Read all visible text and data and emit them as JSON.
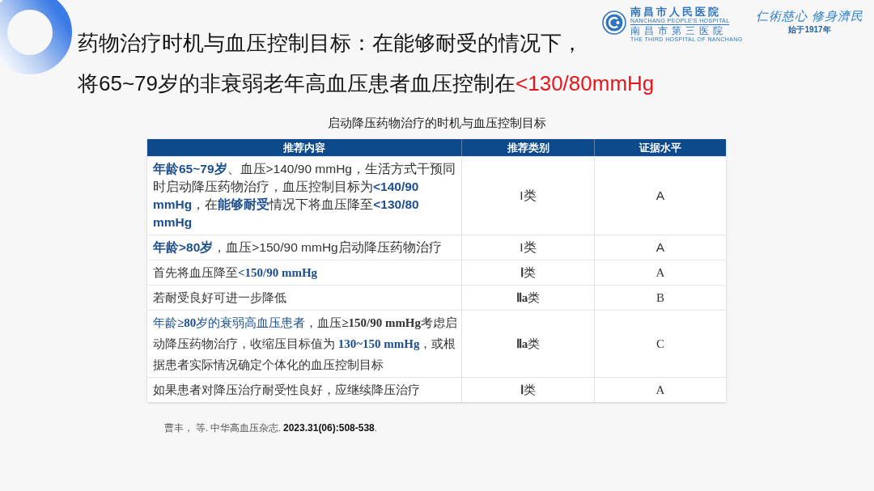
{
  "title": {
    "lines": [
      {
        "runs": [
          {
            "text": "药物治疗时机与血压控制目标：在能够耐受的情况下，",
            "highlight": false
          }
        ]
      },
      {
        "runs": [
          {
            "text": "将65~79岁的非衰弱老年高血压患者血压控制在",
            "highlight": false
          },
          {
            "text": "<130/80mmHg",
            "highlight": true
          }
        ]
      }
    ]
  },
  "logo": {
    "name": "南昌市人民医院",
    "name_en": "NANCHANG PEOPLE'S HOSPITAL",
    "alt_name": "南昌市第三医院",
    "alt_name_en": "THE THIRD HOSPITAL OF NANCHANG"
  },
  "motto": {
    "text": "仁術慈心 修身濟民",
    "since": "始于1917年"
  },
  "table": {
    "caption": "启动降压药物治疗的时机与血压控制目标",
    "columns": [
      "推荐内容",
      "推荐类别",
      "证据水平"
    ],
    "rows": [
      {
        "kind": "main",
        "runs": [
          {
            "text": "**年龄65~79岁**",
            "highlight": true
          },
          {
            "text": "、血压>140/90 mmHg，生活方式干预同时启动降压药物治疗，血压控制目标为",
            "highlight": false
          },
          {
            "text": "**<140/90 mmHg**",
            "highlight": true
          },
          {
            "text": "，在",
            "highlight": false
          },
          {
            "text": "**能够耐受**",
            "highlight": true
          },
          {
            "text": "情况下将血压降至",
            "highlight": false
          },
          {
            "text": "**<130/80 mmHg**",
            "highlight": true
          }
        ],
        "category": "I类",
        "evidence": "A"
      },
      {
        "kind": "main",
        "runs": [
          {
            "text": "**年龄>80岁**",
            "highlight": true
          },
          {
            "text": "，血压>150/90 mmHg启动降压药物治疗",
            "highlight": false
          }
        ],
        "category": "I类",
        "evidence": "A"
      },
      {
        "kind": "detail",
        "runs": [
          {
            "text": "首先将血压降至",
            "highlight": false
          },
          {
            "text": "**<150/90 mmHg**",
            "highlight": true
          }
        ],
        "category": "**Ⅰ**类",
        "evidence": "A"
      },
      {
        "kind": "detail",
        "runs": [
          {
            "text": "若耐受良好可进一步降低",
            "highlight": false
          }
        ],
        "category": "**Ⅱa**类",
        "evidence": "B"
      },
      {
        "kind": "detail",
        "runs": [
          {
            "text": "年龄**≥80**岁的衰弱高血压患者",
            "highlight": true
          },
          {
            "text": "，血压**≥150/90 mmHg**考虑启动降压药物治疗，收缩压目标值为 ",
            "highlight": false
          },
          {
            "text": "**130~150 mmHg**",
            "highlight": true
          },
          {
            "text": "，或根据患者实际情况确定个体化的血压控制目标",
            "highlight": false
          }
        ],
        "category": "**Ⅱa**类",
        "evidence": "C"
      },
      {
        "kind": "detail",
        "runs": [
          {
            "text": "如果患者对降压治疗耐受性良好，应继续降压治疗",
            "highlight": false
          }
        ],
        "category": "**Ⅰ**类",
        "evidence": "A"
      }
    ]
  },
  "citation": "曹丰， 等. 中华高血压杂志. **2023.31(06):508-538**."
}
